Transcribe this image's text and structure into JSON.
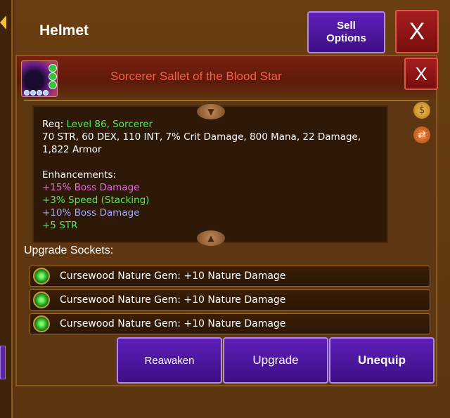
{
  "background": {
    "title": "Helmet",
    "sell_options_label": "Sell\nOptions",
    "close_label": "X"
  },
  "item": {
    "name": "Sorcerer Sallet of the Blood Star",
    "close_label": "X",
    "icon": "hooded-helmet-icon"
  },
  "stats": {
    "req_label": "Req:",
    "req_level": "Level 86, Sorcerer",
    "line1": "70 STR, 60 DEX, 110 INT, 7% Crit Damage, 800 Mana, 22 Damage,",
    "line2": "1,822 Armor",
    "enh_title": "Enhancements:",
    "enhancements": [
      {
        "text": "+15% Boss Damage",
        "color": "#e26ee2"
      },
      {
        "text": "+3% Speed (Stacking)",
        "color": "#58e858"
      },
      {
        "text": "+10% Boss Damage",
        "color": "#a4a8ff"
      },
      {
        "text": "+5 STR",
        "color": "#58e858"
      }
    ]
  },
  "sockets": {
    "title": "Upgrade Sockets:",
    "items": [
      {
        "label": "Cursewood Nature Gem: +10 Nature Damage"
      },
      {
        "label": "Cursewood Nature Gem: +10 Nature Damage"
      },
      {
        "label": "Cursewood Nature Gem: +10 Nature Damage"
      }
    ]
  },
  "actions": {
    "reawaken": "Reawaken",
    "upgrade": "Upgrade",
    "unequip": "Unequip"
  },
  "colors": {
    "item_name": "#ff5a4a",
    "button_purple": "#5e1fb8",
    "close_red": "#a61d1d"
  }
}
